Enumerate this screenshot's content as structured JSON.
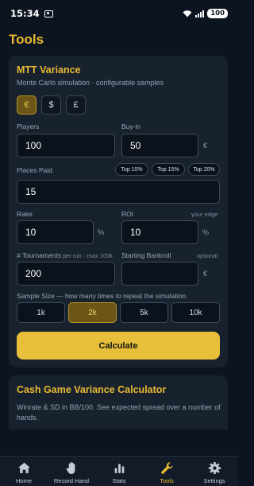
{
  "status": {
    "time": "15:34",
    "battery": "100"
  },
  "page": {
    "title": "Tools"
  },
  "mtt": {
    "title": "MTT Variance",
    "subtitle": "Monte Carlo simulation · configurable samples",
    "currencies": [
      "€",
      "$",
      "£"
    ],
    "selected_currency": "€",
    "players": {
      "label": "Players",
      "value": "100"
    },
    "buyin": {
      "label": "Buy-in",
      "value": "50",
      "unit": "€"
    },
    "places_paid": {
      "label": "Places Paid",
      "value": "15",
      "presets": [
        "Top 10%",
        "Top 15%",
        "Top 20%"
      ]
    },
    "rake": {
      "label": "Rake",
      "value": "10",
      "unit": "%"
    },
    "roi": {
      "label": "ROI",
      "hint": "your edge",
      "value": "10",
      "unit": "%"
    },
    "tournaments": {
      "label": "# Tournaments",
      "hint": "per run · max 100k",
      "value": "200"
    },
    "bankroll": {
      "label": "Starting Bankroll",
      "hint": "optional",
      "value": "",
      "unit": "€"
    },
    "sample_size": {
      "label": "Sample Size",
      "hint": "— how many times to repeat the simulation",
      "options": [
        "1k",
        "2k",
        "5k",
        "10k"
      ],
      "selected": "2k"
    },
    "calculate_label": "Calculate"
  },
  "cash": {
    "title": "Cash Game Variance Calculator",
    "subtitle": "Winrate & SD in BB/100. See expected spread over a number of hands."
  },
  "tabs": [
    {
      "label": "Home",
      "icon": "home-icon"
    },
    {
      "label": "Record Hand",
      "icon": "hand-icon"
    },
    {
      "label": "Stats",
      "icon": "bar-chart-icon"
    },
    {
      "label": "Tools",
      "icon": "wrench-icon"
    },
    {
      "label": "Settings",
      "icon": "gear-icon"
    }
  ],
  "active_tab": "Tools",
  "colors": {
    "accent": "#e8b931",
    "background": "#0c1420",
    "card": "#18222f",
    "button": "#e7bf3a"
  }
}
